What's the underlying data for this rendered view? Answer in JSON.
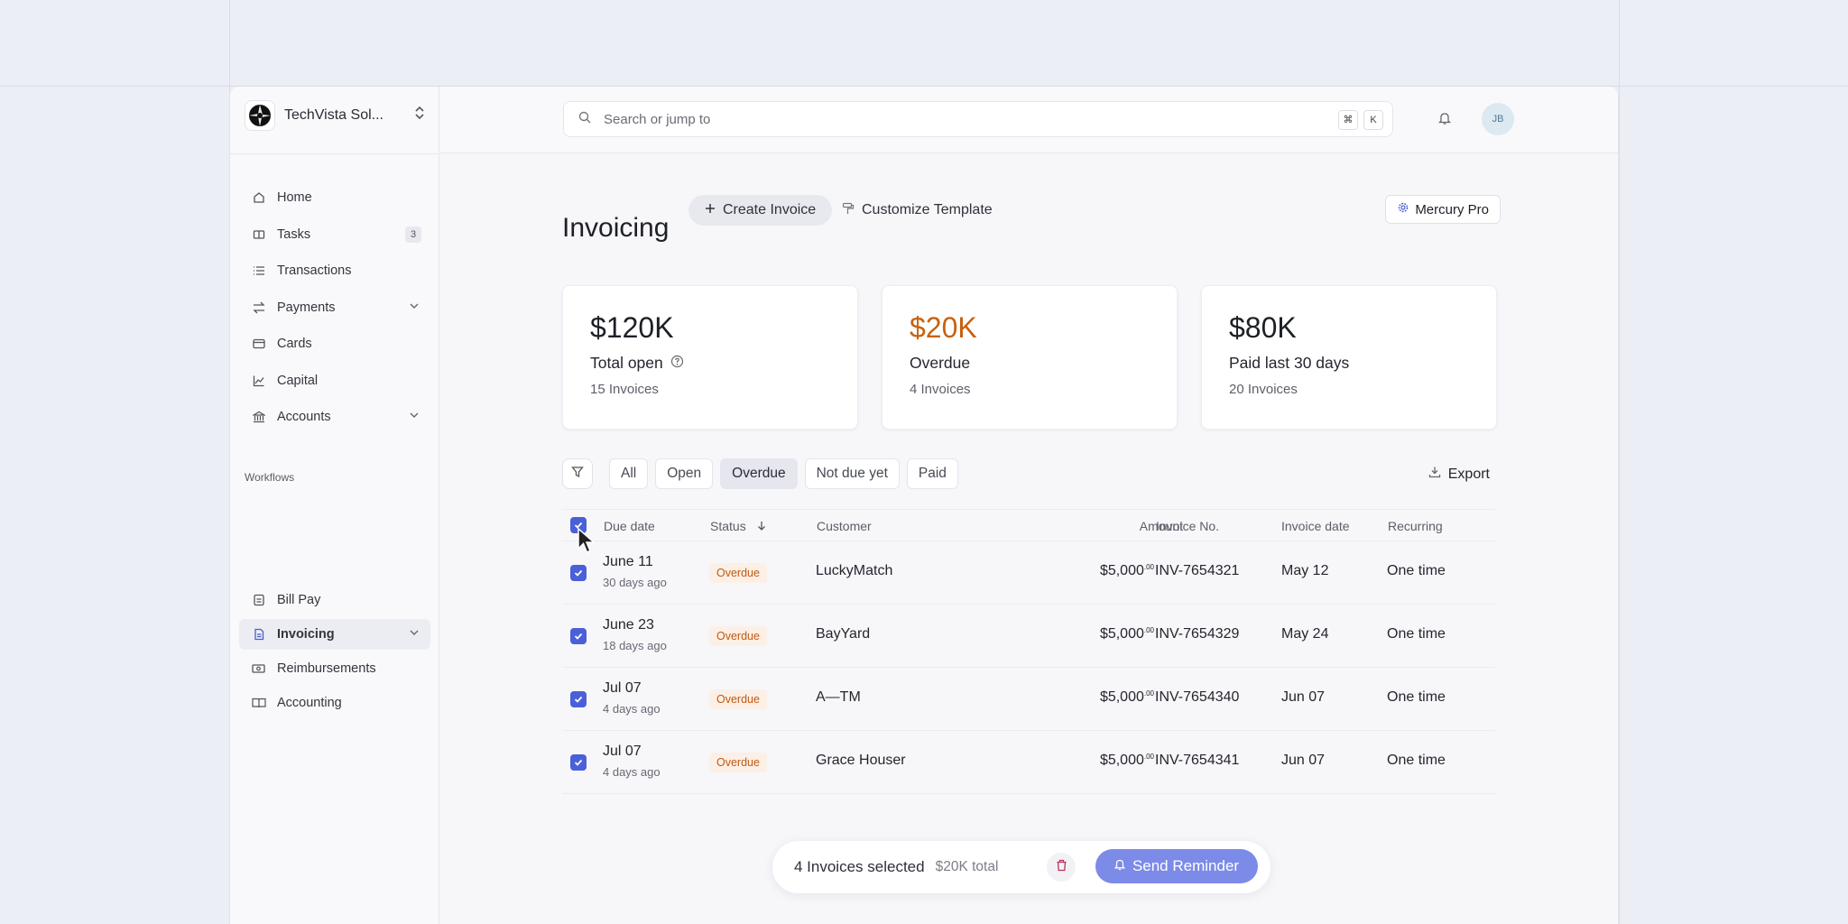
{
  "org": {
    "name": "TechVista Sol..."
  },
  "nav": {
    "items": [
      {
        "label": "Home",
        "icon": "home-icon"
      },
      {
        "label": "Tasks",
        "icon": "tasks-icon",
        "badge": "3"
      },
      {
        "label": "Transactions",
        "icon": "list-icon"
      },
      {
        "label": "Payments",
        "icon": "transfer-icon"
      },
      {
        "label": "Cards",
        "icon": "card-icon"
      },
      {
        "label": "Capital",
        "icon": "chart-icon"
      },
      {
        "label": "Accounts",
        "icon": "bank-icon"
      }
    ],
    "section_label": "Workflows",
    "workflows": [
      {
        "label": "Bill Pay",
        "icon": "bill-icon"
      },
      {
        "label": "Invoicing",
        "icon": "document-icon",
        "active": true
      },
      {
        "label": "Reimbursements",
        "icon": "receipt-icon"
      },
      {
        "label": "Accounting",
        "icon": "book-icon"
      }
    ]
  },
  "search": {
    "placeholder": "Search or jump to",
    "shortcut_1": "⌘",
    "shortcut_2": "K"
  },
  "user": {
    "initials": "JB"
  },
  "page": {
    "title": "Invoicing",
    "create_label": "Create Invoice",
    "customize_label": "Customize Template",
    "plan_label": "Mercury Pro"
  },
  "stats": [
    {
      "value": "$120K",
      "label": "Total open",
      "sub": "15 Invoices"
    },
    {
      "value": "$20K",
      "label": "Overdue",
      "sub": "4 Invoices",
      "accent": "#c8620f"
    },
    {
      "value": "$80K",
      "label": "Paid last 30 days",
      "sub": "20 Invoices"
    }
  ],
  "filters": [
    "All",
    "Open",
    "Overdue",
    "Not due yet",
    "Paid"
  ],
  "active_filter": "Overdue",
  "export_label": "Export",
  "table": {
    "headers": {
      "due_date": "Due date",
      "status": "Status",
      "customer": "Customer",
      "amount": "Amount",
      "invoice_no": "Invoice No.",
      "invoice_date": "Invoice date",
      "recurring": "Recurring"
    },
    "rows": [
      {
        "due": "June 11",
        "due_sub": "30 days ago",
        "status": "Overdue",
        "customer": "LuckyMatch",
        "amount": "$5,000",
        "cents": ".00",
        "invoice_no": "INV-7654321",
        "invoice_date": "May 12",
        "recurring": "One time"
      },
      {
        "due": "June 23",
        "due_sub": "18 days ago",
        "status": "Overdue",
        "customer": "BayYard",
        "amount": "$5,000",
        "cents": ".00",
        "invoice_no": "INV-7654329",
        "invoice_date": "May 24",
        "recurring": "One time"
      },
      {
        "due": "Jul 07",
        "due_sub": "4 days ago",
        "status": "Overdue",
        "customer": "A—TM",
        "amount": "$5,000",
        "cents": ".00",
        "invoice_no": "INV-7654340",
        "invoice_date": "Jun 07",
        "recurring": "One time"
      },
      {
        "due": "Jul 07",
        "due_sub": "4 days ago",
        "status": "Overdue",
        "customer": "Grace Houser",
        "amount": "$5,000",
        "cents": ".00",
        "invoice_no": "INV-7654341",
        "invoice_date": "Jun 07",
        "recurring": "One time"
      }
    ]
  },
  "selection": {
    "count_label": "4 Invoices selected",
    "total_label": "$20K total",
    "remind_label": "Send Reminder"
  },
  "colors": {
    "accent": "#4a60d8",
    "overdue": "#c8620f",
    "remind_button": "#7c8ae8"
  }
}
